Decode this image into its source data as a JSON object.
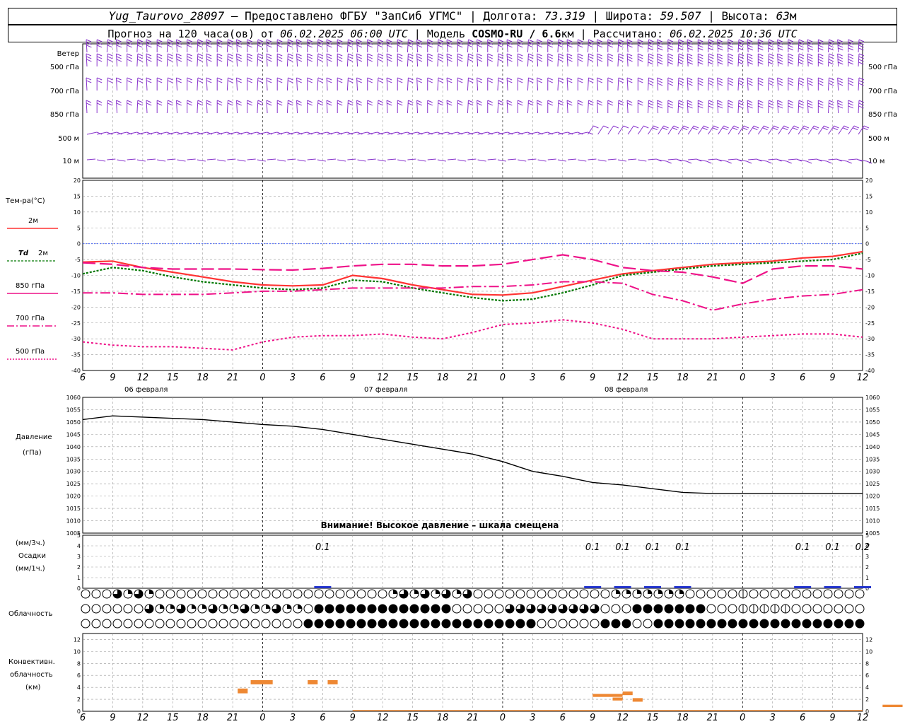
{
  "header": {
    "station": "Yug_Taurovo_28097",
    "provided_by": " – Предоставлено ФГБУ \"ЗапСиб УГМС\" | Долгота: ",
    "lon": "73.319",
    "lat_label": " | Широта: ",
    "lat": "59.507",
    "alt_label": " | Высота: ",
    "alt": "63",
    "alt_unit": "м",
    "forecast_label": "Прогноз на 120 часа(ов) от ",
    "forecast_from": "06.02.2025 06:00 UTC",
    "model_label": " | Модель ",
    "model": "COSMO-RU / 6.6",
    "model_unit": "км",
    "calc_label": " | Рассчитано: ",
    "calc_time": "06.02.2025 10:36 UTC"
  },
  "labels": {
    "wind": "Ветер",
    "wind_levels": [
      "500 гПа",
      "700 гПа",
      "850 гПа",
      "500 м",
      "10 м"
    ],
    "temp": "Тем-ра(°C)",
    "t2m": "2м",
    "td": "Td",
    "td2m": "2м",
    "t850": "850 гПа",
    "t700": "700 гПа",
    "t500": "500 гПа",
    "pressure": "Давление",
    "pressure_unit": "(гПа)",
    "warning": "Внимание! Высокое давление – шкала смещена",
    "precip_3h": "(мм/3ч.)",
    "precip": "Осадки",
    "precip_1h": "(мм/1ч.)",
    "cloud": "Облачность",
    "conv1": "Конвективн.",
    "conv2": "облачность",
    "conv3": "(км)"
  },
  "dates": [
    "06 февраля",
    "07 февраля",
    "08 февраля"
  ],
  "colors": {
    "t2m": "#ff3333",
    "td": "#007700",
    "t850": "#ee1188",
    "t700": "#ee1188",
    "t500": "#ee1188",
    "wind": "#8833cc",
    "pressure": "#000000",
    "precip": "#2233cc",
    "conv": "#ee8833",
    "zero": "#3355ff"
  },
  "chart_data": [
    {
      "type": "line",
      "title": "Тем-ра(°C)",
      "x_hours": [
        6,
        9,
        12,
        15,
        18,
        21,
        0,
        3,
        6,
        9,
        12,
        15,
        18,
        21,
        0,
        3,
        6,
        9,
        12,
        15,
        18,
        21,
        0,
        3,
        6,
        9,
        12
      ],
      "ylim": [
        -40,
        20
      ],
      "y_ticks": [
        20,
        15,
        10,
        5,
        0,
        -5,
        -10,
        -15,
        -20,
        -25,
        -30,
        -35,
        -40
      ],
      "series": [
        {
          "name": "2м",
          "values": [
            -5.8,
            -5.5,
            -7.5,
            -9,
            -10.5,
            -12,
            -13,
            -13.3,
            -13,
            -10,
            -11,
            -13,
            -14.5,
            -16,
            -16.2,
            -15.5,
            -13.5,
            -11.5,
            -9.5,
            -8.5,
            -7.5,
            -6.5,
            -6,
            -5.5,
            -4.5,
            -4,
            -2.5
          ]
        },
        {
          "name": "Td 2м",
          "values": [
            -9.5,
            -7.5,
            -8.5,
            -10.5,
            -12,
            -13,
            -14,
            -14.5,
            -14,
            -11.5,
            -12,
            -14,
            -15.5,
            -17,
            -18,
            -17.5,
            -15.5,
            -13,
            -10,
            -9,
            -8,
            -7,
            -6.5,
            -6,
            -5.5,
            -5,
            -3
          ]
        },
        {
          "name": "850 гПа",
          "values": [
            -6,
            -6.5,
            -7.5,
            -8,
            -8,
            -8,
            -8.2,
            -8.3,
            -7.8,
            -7,
            -6.5,
            -6.5,
            -7,
            -7,
            -6.5,
            -5,
            -3.5,
            -5,
            -7.5,
            -8.5,
            -9,
            -10.5,
            -12.5,
            -8,
            -7,
            -7,
            -8
          ]
        },
        {
          "name": "700 гПа",
          "values": [
            -15.5,
            -15.5,
            -16,
            -16,
            -16,
            -15.5,
            -15,
            -15,
            -14.5,
            -14,
            -14,
            -14,
            -14,
            -13.5,
            -13.5,
            -13,
            -12,
            -12,
            -12.5,
            -16,
            -18,
            -21,
            -19,
            -17.5,
            -16.5,
            -16,
            -14.5
          ]
        },
        {
          "name": "500 гПа",
          "values": [
            -31,
            -32,
            -32.5,
            -32.5,
            -33,
            -33.5,
            -31,
            -29.5,
            -29,
            -29,
            -28.5,
            -29.5,
            -30,
            -28,
            -25.5,
            -25,
            -24,
            -25,
            -27,
            -30,
            -30,
            -30,
            -29.5,
            -29,
            -28.5,
            -28.5,
            -29.5
          ]
        }
      ]
    },
    {
      "type": "line",
      "title": "Давление",
      "ylabel": "(гПа)",
      "ylim": [
        1005,
        1060
      ],
      "y_ticks": [
        1060,
        1055,
        1050,
        1045,
        1040,
        1035,
        1030,
        1025,
        1020,
        1015,
        1010,
        1005
      ],
      "x_hours": [
        6,
        9,
        12,
        15,
        18,
        21,
        0,
        3,
        6,
        9,
        12,
        15,
        18,
        21,
        0,
        3,
        6,
        9,
        12,
        15,
        18,
        21,
        0,
        3,
        6,
        9,
        12
      ],
      "series": [
        {
          "values": [
            1051,
            1052.5,
            1052,
            1051.5,
            1051,
            1050,
            1049,
            1048.3,
            1047,
            1045,
            1043,
            1041,
            1039,
            1037,
            1034,
            1030,
            1028,
            1025.5,
            1024.5,
            1023,
            1021.5,
            1021,
            1021,
            1021,
            1021,
            1021,
            1021
          ]
        }
      ]
    },
    {
      "type": "bar",
      "title": "Осадки",
      "ylim": [
        0,
        5
      ],
      "y_ticks": [
        5,
        4,
        3,
        2,
        1,
        0
      ],
      "annotations": [
        {
          "x_index": 8,
          "text": "0.1"
        },
        {
          "x_index": 17,
          "text": "0.1"
        },
        {
          "x_index": 18,
          "text": "0.1"
        },
        {
          "x_index": 19,
          "text": "0.1"
        },
        {
          "x_index": 20,
          "text": "0.1"
        },
        {
          "x_index": 24,
          "text": "0.1"
        },
        {
          "x_index": 25,
          "text": "0.1"
        },
        {
          "x_index": 26,
          "text": "0.2"
        }
      ]
    },
    {
      "type": "bar",
      "title": "Конвективн. облачность (км)",
      "ylim": [
        0,
        13
      ],
      "y_ticks": [
        12,
        10,
        8,
        6,
        4,
        2,
        0
      ],
      "segments": [
        {
          "from_h": 15.5,
          "to_h": 16.5,
          "bottom": 3,
          "top": 3.8
        },
        {
          "from_h": 16.8,
          "to_h": 19,
          "bottom": 4.5,
          "top": 5.2
        },
        {
          "from_h": 22.5,
          "to_h": 23.5,
          "bottom": 4.5,
          "top": 5.2
        },
        {
          "from_h": 24.5,
          "to_h": 25.5,
          "bottom": 4.5,
          "top": 5.2
        },
        {
          "from_h": 51,
          "to_h": 54,
          "bottom": 2.4,
          "top": 2.9
        },
        {
          "from_h": 53,
          "to_h": 54,
          "bottom": 1.8,
          "top": 2.3
        },
        {
          "from_h": 54,
          "to_h": 55,
          "bottom": 2.7,
          "top": 3.3
        },
        {
          "from_h": 55,
          "to_h": 56,
          "bottom": 1.6,
          "top": 2.2
        },
        {
          "from_h": 80,
          "to_h": 82,
          "bottom": 0.7,
          "top": 1.1
        }
      ]
    }
  ]
}
